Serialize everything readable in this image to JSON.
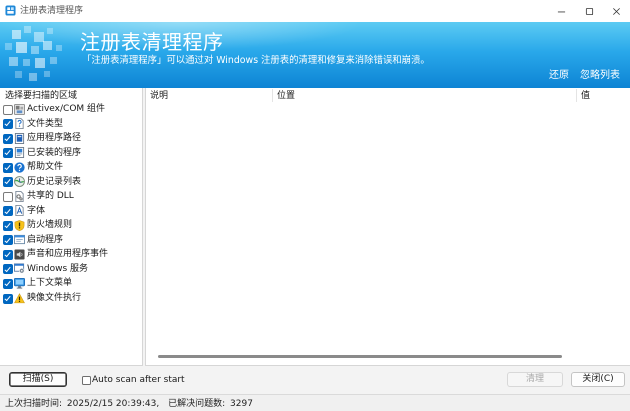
{
  "window": {
    "title": "注册表清理程序",
    "controls": [
      "minimize-icon",
      "maximize-icon",
      "close-icon"
    ]
  },
  "banner": {
    "title": "注册表清理程序",
    "subtitle": "「注册表清理程序」可以通过对 Windows 注册表的清理和修复来消除错误和崩溃。",
    "restore_link": "还原",
    "ignore_list_link": "忽略列表"
  },
  "scan_areas": {
    "header": "选择要扫描的区域",
    "items": [
      {
        "label": "Activex/COM 组件",
        "checked": false,
        "icon": "activex-component-icon"
      },
      {
        "label": "文件类型",
        "checked": true,
        "icon": "file-type-icon"
      },
      {
        "label": "应用程序路径",
        "checked": true,
        "icon": "app-path-icon"
      },
      {
        "label": "已安装的程序",
        "checked": true,
        "icon": "installed-program-icon"
      },
      {
        "label": "帮助文件",
        "checked": true,
        "icon": "help-icon"
      },
      {
        "label": "历史记录列表",
        "checked": true,
        "icon": "history-icon"
      },
      {
        "label": "共享的 DLL",
        "checked": false,
        "icon": "shared-dll-icon"
      },
      {
        "label": "字体",
        "checked": true,
        "icon": "font-icon"
      },
      {
        "label": "防火墙规则",
        "checked": true,
        "icon": "firewall-shield-icon"
      },
      {
        "label": "启动程序",
        "checked": true,
        "icon": "startup-program-icon"
      },
      {
        "label": "声音和应用程序事件",
        "checked": true,
        "icon": "sound-icon"
      },
      {
        "label": "Windows 服务",
        "checked": true,
        "icon": "windows-service-icon"
      },
      {
        "label": "上下文菜单",
        "checked": true,
        "icon": "context-menu-icon"
      },
      {
        "label": "映像文件执行",
        "checked": true,
        "icon": "warning-icon"
      }
    ]
  },
  "results_table": {
    "columns": [
      "说明",
      "位置",
      "值"
    ]
  },
  "toolbar": {
    "scan_label": "扫描(S)",
    "auto_scan_label": "Auto scan after start",
    "auto_scan_checked": false,
    "clean_label": "清理",
    "clean_enabled": false,
    "close_label": "关闭(C)"
  },
  "status": {
    "last_scan_label": "上次扫描时间:",
    "last_scan_time": "2025/2/15 20:39:43,",
    "resolved_label": "已解决问题数:",
    "resolved_count": "3297"
  },
  "colors": {
    "accent": "#0067c0",
    "banner_top": "#5ccbf3",
    "banner_bottom": "#0d84d4"
  }
}
